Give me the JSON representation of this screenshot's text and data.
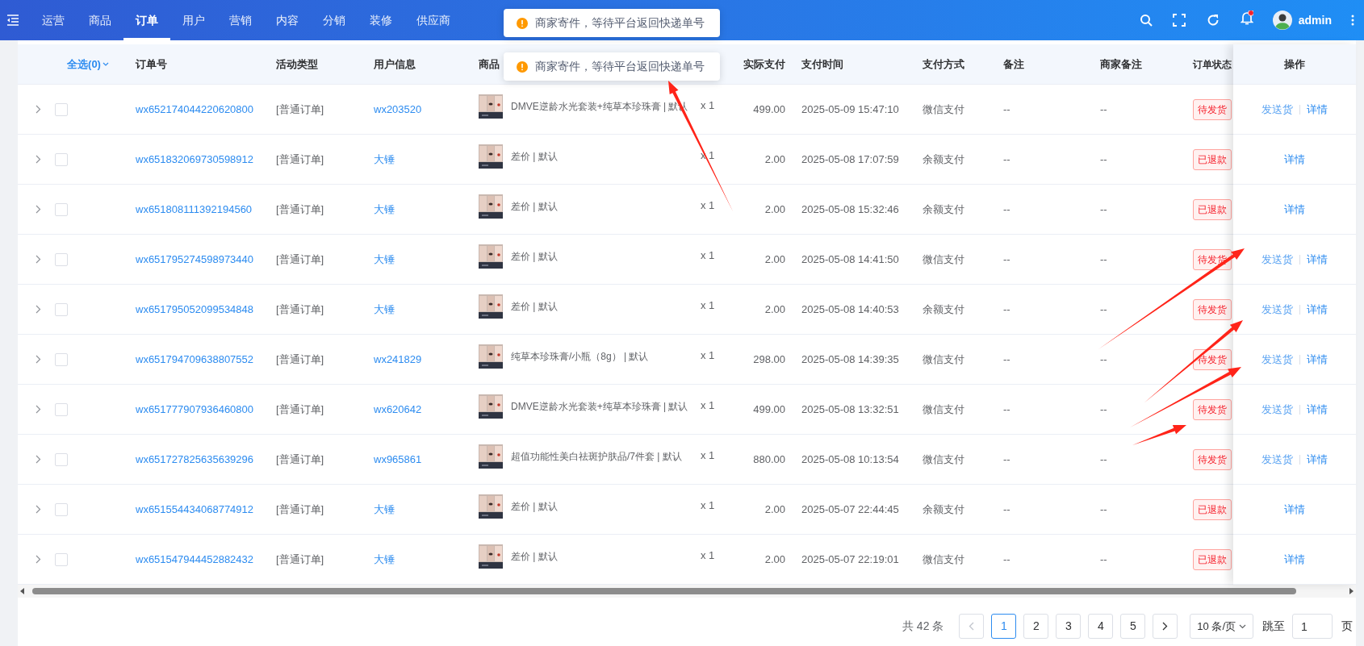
{
  "topbar": {
    "nav": [
      {
        "label": "运营",
        "selected": false
      },
      {
        "label": "商品",
        "selected": false
      },
      {
        "label": "订单",
        "selected": true
      },
      {
        "label": "用户",
        "selected": false
      },
      {
        "label": "营销",
        "selected": false
      },
      {
        "label": "内容",
        "selected": false
      },
      {
        "label": "分销",
        "selected": false
      },
      {
        "label": "装修",
        "selected": false
      },
      {
        "label": "供应商",
        "selected": false
      }
    ],
    "notification_dot": true,
    "user": "admin"
  },
  "toasts": [
    "商家寄件，等待平台返回快递单号",
    "商家寄件，等待平台返回快递单号"
  ],
  "table": {
    "select_all": "全选(0)",
    "columns": [
      "订单号",
      "活动类型",
      "用户信息",
      "商品",
      "实际支付",
      "支付时间",
      "支付方式",
      "备注",
      "商家备注",
      "订单状态",
      "操作"
    ],
    "rows": [
      {
        "order_no": "wx652174044220620800",
        "activity": "[普通订单]",
        "user": "wx203520",
        "product": {
          "name": "DMVE逆龄水光套装+纯草本珍珠膏 | 默认"
        },
        "qty": "x 1",
        "paid": "499.00",
        "time": "2025-05-09 15:47:10",
        "method": "微信支付",
        "remark": "--",
        "merchant_remark": "--",
        "status": "待发货",
        "checked": false,
        "actions": [
          "发送货",
          "详情"
        ]
      },
      {
        "order_no": "wx651832069730598912",
        "activity": "[普通订单]",
        "user": "大锤",
        "product": {
          "name": "差价 | 默认"
        },
        "qty": "x 1",
        "paid": "2.00",
        "time": "2025-05-08 17:07:59",
        "method": "余额支付",
        "remark": "--",
        "merchant_remark": "--",
        "status": "已退款",
        "checked": false,
        "actions": [
          "详情"
        ]
      },
      {
        "order_no": "wx651808111392194560",
        "activity": "[普通订单]",
        "user": "大锤",
        "product": {
          "name": "差价 | 默认"
        },
        "qty": "x 1",
        "paid": "2.00",
        "time": "2025-05-08 15:32:46",
        "method": "余额支付",
        "remark": "--",
        "merchant_remark": "--",
        "status": "已退款",
        "checked": false,
        "actions": [
          "详情"
        ]
      },
      {
        "order_no": "wx651795274598973440",
        "activity": "[普通订单]",
        "user": "大锤",
        "product": {
          "name": "差价 | 默认"
        },
        "qty": "x 1",
        "paid": "2.00",
        "time": "2025-05-08 14:41:50",
        "method": "微信支付",
        "remark": "--",
        "merchant_remark": "--",
        "status": "待发货",
        "checked": false,
        "actions": [
          "发送货",
          "详情"
        ]
      },
      {
        "order_no": "wx651795052099534848",
        "activity": "[普通订单]",
        "user": "大锤",
        "product": {
          "name": "差价 | 默认"
        },
        "qty": "x 1",
        "paid": "2.00",
        "time": "2025-05-08 14:40:53",
        "method": "余额支付",
        "remark": "--",
        "merchant_remark": "--",
        "status": "待发货",
        "checked": false,
        "actions": [
          "发送货",
          "详情"
        ]
      },
      {
        "order_no": "wx651794709638807552",
        "activity": "[普通订单]",
        "user": "wx241829",
        "product": {
          "name": "纯草本珍珠膏/小瓶（8g） | 默认"
        },
        "qty": "x 1",
        "paid": "298.00",
        "time": "2025-05-08 14:39:35",
        "method": "微信支付",
        "remark": "--",
        "merchant_remark": "--",
        "status": "待发货",
        "checked": false,
        "actions": [
          "发送货",
          "详情"
        ]
      },
      {
        "order_no": "wx651777907936460800",
        "activity": "[普通订单]",
        "user": "wx620642",
        "product": {
          "name": "DMVE逆龄水光套装+纯草本珍珠膏 | 默认"
        },
        "qty": "x 1",
        "paid": "499.00",
        "time": "2025-05-08 13:32:51",
        "method": "微信支付",
        "remark": "--",
        "merchant_remark": "--",
        "status": "待发货",
        "checked": false,
        "actions": [
          "发送货",
          "详情"
        ]
      },
      {
        "order_no": "wx651727825635639296",
        "activity": "[普通订单]",
        "user": "wx965861",
        "product": {
          "name": "超值功能性美白祛斑护肤品/7件套 | 默认"
        },
        "qty": "x 1",
        "paid": "880.00",
        "time": "2025-05-08 10:13:54",
        "method": "微信支付",
        "remark": "--",
        "merchant_remark": "--",
        "status": "待发货",
        "checked": false,
        "actions": [
          "发送货",
          "详情"
        ]
      },
      {
        "order_no": "wx651554434068774912",
        "activity": "[普通订单]",
        "user": "大锤",
        "product": {
          "name": "差价 | 默认"
        },
        "qty": "x 1",
        "paid": "2.00",
        "time": "2025-05-07 22:44:45",
        "method": "余额支付",
        "remark": "--",
        "merchant_remark": "--",
        "status": "已退款",
        "checked": false,
        "actions": [
          "详情"
        ]
      },
      {
        "order_no": "wx651547944452882432",
        "activity": "[普通订单]",
        "user": "大锤",
        "product": {
          "name": "差价 | 默认"
        },
        "qty": "x 1",
        "paid": "2.00",
        "time": "2025-05-07 22:19:01",
        "method": "微信支付",
        "remark": "--",
        "merchant_remark": "--",
        "status": "已退款",
        "checked": false,
        "actions": [
          "详情"
        ]
      }
    ]
  },
  "pagination": {
    "total": "共 42 条",
    "pages": [
      {
        "label": "1",
        "selected": true
      },
      {
        "label": "2",
        "selected": false
      },
      {
        "label": "3",
        "selected": false
      },
      {
        "label": "4",
        "selected": false
      },
      {
        "label": "5",
        "selected": false
      }
    ],
    "prev_disabled": true,
    "page_size": "10 条/页",
    "jump_label": "跳至",
    "jump_value": "1",
    "jump_suffix": "页"
  }
}
